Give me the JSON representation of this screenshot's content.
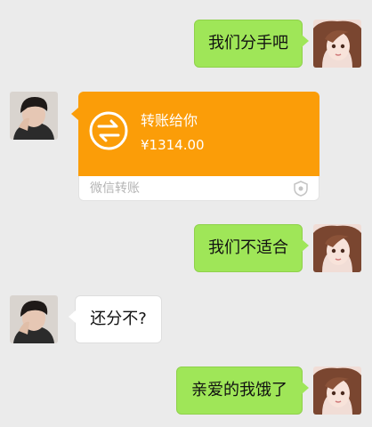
{
  "colors": {
    "background": "#ebebeb",
    "sent_bubble": "#9fe658",
    "received_bubble": "#ffffff",
    "transfer_orange": "#fb9d08"
  },
  "messages": [
    {
      "side": "right",
      "type": "text",
      "text": "我们分手吧"
    },
    {
      "side": "left",
      "type": "transfer",
      "title": "转账给你",
      "amount": "¥1314.00",
      "footer": "微信转账",
      "icon": "transfer-arrows-icon"
    },
    {
      "side": "right",
      "type": "text",
      "text": "我们不适合"
    },
    {
      "side": "left",
      "type": "text",
      "text": "还分不?"
    },
    {
      "side": "right",
      "type": "text",
      "text": "亲爱的我饿了"
    }
  ]
}
